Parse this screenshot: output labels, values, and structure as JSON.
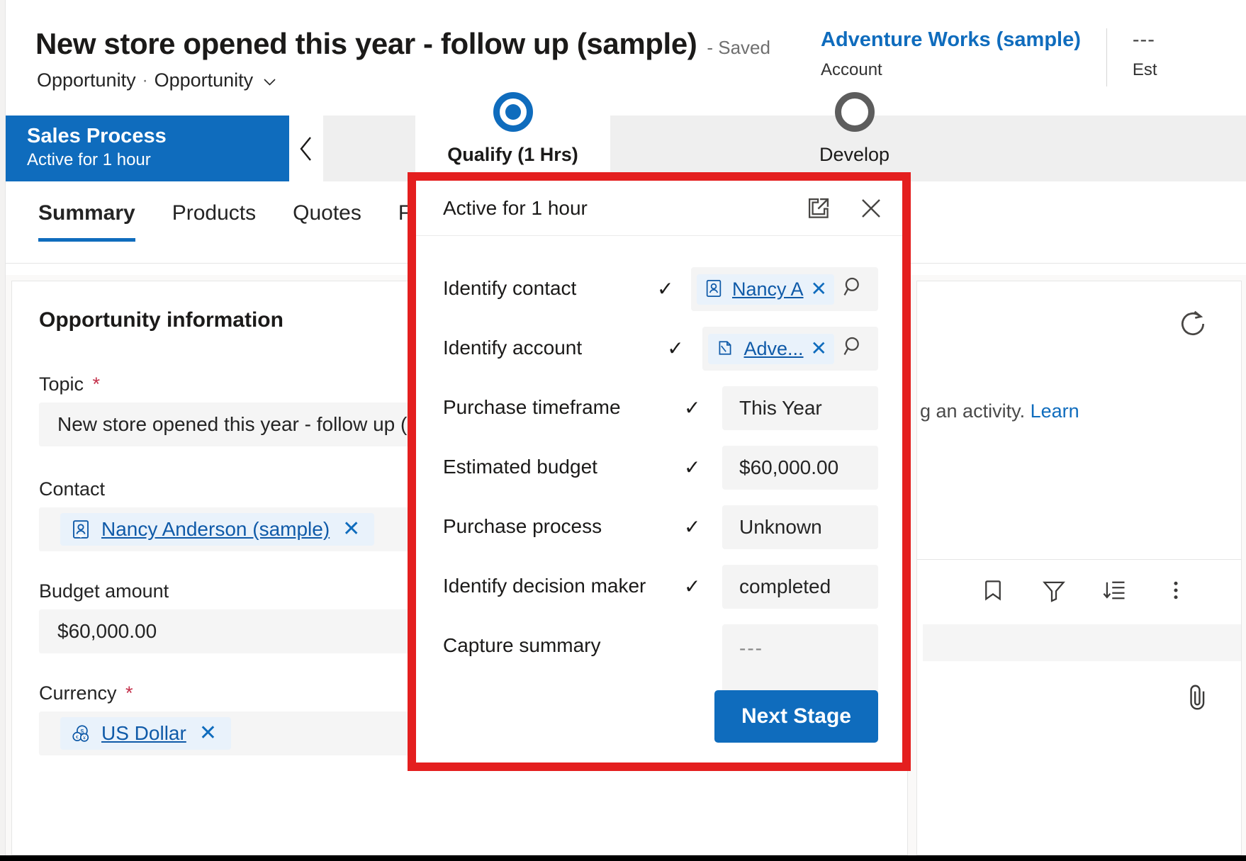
{
  "header": {
    "record_title": "New store opened this year - follow up (sample)",
    "saved_status": "- Saved",
    "entity_label": "Opportunity",
    "separator": "·",
    "form_name": "Opportunity",
    "form_chevron_icon": "chevron-down-icon",
    "related": {
      "account_name": "Adventure Works (sample)",
      "account_label": "Account",
      "est_value": "---",
      "est_label": "Est"
    }
  },
  "process": {
    "stage_header_title": "Sales Process",
    "stage_header_sub": "Active for 1 hour",
    "collapse_icon": "chevron-left-icon",
    "stages": [
      {
        "label": "Qualify  (1 Hrs)",
        "state": "current"
      },
      {
        "label": "Develop",
        "state": "todo"
      }
    ]
  },
  "tabs": [
    {
      "label": "Summary",
      "active": true
    },
    {
      "label": "Products",
      "active": false
    },
    {
      "label": "Quotes",
      "active": false
    },
    {
      "label": "Fil",
      "active": false
    }
  ],
  "form": {
    "section_title": "Opportunity information",
    "fields": [
      {
        "label": "Topic",
        "required": true,
        "type": "text",
        "value": "New store opened this year - follow up (s"
      },
      {
        "label": "Contact",
        "required": false,
        "type": "lookup",
        "value": "Nancy Anderson (sample)",
        "icon": "contact-icon",
        "clear_icon": "close-icon"
      },
      {
        "label": "Budget amount",
        "required": false,
        "type": "text",
        "value": "$60,000.00"
      },
      {
        "label": "Currency",
        "required": true,
        "type": "lookup",
        "value": "US Dollar",
        "icon": "currency-icon",
        "clear_icon": "close-icon"
      }
    ]
  },
  "timeline": {
    "refresh_icon": "refresh-icon",
    "message_text": "g an activity.",
    "message_link": "Learn",
    "toolbar_icons": [
      "bookmark-icon",
      "filter-icon",
      "sort-icon",
      "more-options-icon"
    ],
    "attach_icon": "attachment-icon"
  },
  "flyout": {
    "title": "Active for 1 hour",
    "expand_icon": "pop-out-icon",
    "close_icon": "close-icon",
    "check_glyph": "✓",
    "search_icon": "search-icon",
    "steps": [
      {
        "label": "Identify contact",
        "completed": true,
        "type": "lookup",
        "value": "Nancy A",
        "icon": "contact-icon",
        "clear_icon": "close-icon"
      },
      {
        "label": "Identify account",
        "completed": true,
        "type": "lookup",
        "value": "Adve...",
        "icon": "account-icon",
        "clear_icon": "close-icon"
      },
      {
        "label": "Purchase timeframe",
        "completed": true,
        "type": "text",
        "value": "This Year"
      },
      {
        "label": "Estimated budget",
        "completed": true,
        "type": "text",
        "value": "$60,000.00"
      },
      {
        "label": "Purchase process",
        "completed": true,
        "type": "text",
        "value": "Unknown"
      },
      {
        "label": "Identify decision maker",
        "completed": true,
        "type": "text",
        "value": "completed"
      },
      {
        "label": "Capture summary",
        "completed": false,
        "type": "textarea",
        "value": "---"
      }
    ],
    "next_stage_label": "Next Stage"
  },
  "colors": {
    "accent_blue": "#0f6cbd",
    "link_blue": "#0f5aa8",
    "highlight_red": "#e41f1f",
    "field_grey": "#f4f4f4",
    "required_red": "#c4314b"
  }
}
